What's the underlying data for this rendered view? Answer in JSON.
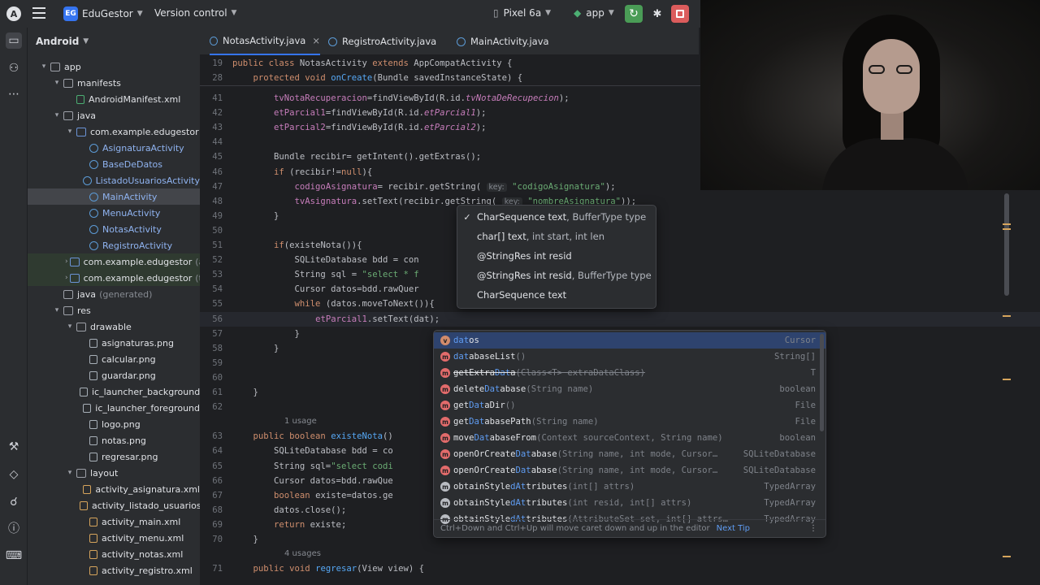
{
  "topbar": {
    "logo_glyph": "A",
    "project_badge": "EG",
    "project_name": "EduGestor",
    "version_control": "Version control",
    "device": "Pixel 6a",
    "run_config": "app"
  },
  "sidebar_title": "Android",
  "tree": [
    {
      "label": "app",
      "indent": 0,
      "arrow": "open",
      "icon": "folder"
    },
    {
      "label": "manifests",
      "indent": 1,
      "arrow": "open",
      "icon": "folder"
    },
    {
      "label": "AndroidManifest.xml",
      "indent": 2,
      "arrow": "none",
      "icon": "mf"
    },
    {
      "label": "java",
      "indent": 1,
      "arrow": "open",
      "icon": "folder"
    },
    {
      "label": "com.example.edugestor",
      "indent": 2,
      "arrow": "open",
      "icon": "folder"
    },
    {
      "label": "AsignaturaActivity",
      "indent": 3,
      "arrow": "none",
      "icon": "class"
    },
    {
      "label": "BaseDeDatos",
      "indent": 3,
      "arrow": "none",
      "icon": "class"
    },
    {
      "label": "ListadoUsuariosActivity",
      "indent": 3,
      "arrow": "none",
      "icon": "class"
    },
    {
      "label": "MainActivity",
      "indent": 3,
      "arrow": "none",
      "icon": "class",
      "selected": true
    },
    {
      "label": "MenuActivity",
      "indent": 3,
      "arrow": "none",
      "icon": "class"
    },
    {
      "label": "NotasActivity",
      "indent": 3,
      "arrow": "none",
      "icon": "class"
    },
    {
      "label": "RegistroActivity",
      "indent": 3,
      "arrow": "none",
      "icon": "class"
    },
    {
      "label": "com.example.edugestor",
      "suffix": "(a",
      "indent": 2,
      "arrow": "closed",
      "icon": "folder",
      "green": true
    },
    {
      "label": "com.example.edugestor",
      "suffix": "(te",
      "indent": 2,
      "arrow": "closed",
      "icon": "folder",
      "green": true
    },
    {
      "label": "java",
      "suffix": "(generated)",
      "indent": 1,
      "arrow": "none",
      "icon": "folder"
    },
    {
      "label": "res",
      "indent": 1,
      "arrow": "open",
      "icon": "folder"
    },
    {
      "label": "drawable",
      "indent": 2,
      "arrow": "open",
      "icon": "folder"
    },
    {
      "label": "asignaturas.png",
      "indent": 3,
      "arrow": "none",
      "icon": "file"
    },
    {
      "label": "calcular.png",
      "indent": 3,
      "arrow": "none",
      "icon": "file"
    },
    {
      "label": "guardar.png",
      "indent": 3,
      "arrow": "none",
      "icon": "file"
    },
    {
      "label": "ic_launcher_background",
      "indent": 3,
      "arrow": "none",
      "icon": "file"
    },
    {
      "label": "ic_launcher_foreground",
      "indent": 3,
      "arrow": "none",
      "icon": "file"
    },
    {
      "label": "logo.png",
      "indent": 3,
      "arrow": "none",
      "icon": "file"
    },
    {
      "label": "notas.png",
      "indent": 3,
      "arrow": "none",
      "icon": "file"
    },
    {
      "label": "regresar.png",
      "indent": 3,
      "arrow": "none",
      "icon": "file"
    },
    {
      "label": "layout",
      "indent": 2,
      "arrow": "open",
      "icon": "folder"
    },
    {
      "label": "activity_asignatura.xml",
      "indent": 3,
      "arrow": "none",
      "icon": "xml"
    },
    {
      "label": "activity_listado_usuarios",
      "indent": 3,
      "arrow": "none",
      "icon": "xml"
    },
    {
      "label": "activity_main.xml",
      "indent": 3,
      "arrow": "none",
      "icon": "xml"
    },
    {
      "label": "activity_menu.xml",
      "indent": 3,
      "arrow": "none",
      "icon": "xml"
    },
    {
      "label": "activity_notas.xml",
      "indent": 3,
      "arrow": "none",
      "icon": "xml"
    },
    {
      "label": "activity_registro.xml",
      "indent": 3,
      "arrow": "none",
      "icon": "xml"
    }
  ],
  "tabs": [
    {
      "label": "NotasActivity.java",
      "active": true,
      "close": "×"
    },
    {
      "label": "RegistroActivity.java",
      "active": false
    },
    {
      "label": "MainActivity.java",
      "active": false
    }
  ],
  "sticky_lines": [
    {
      "num": "19",
      "segments": [
        [
          "kw",
          "public class "
        ],
        [
          "",
          "NotasActivity "
        ],
        [
          "kw",
          "extends "
        ],
        [
          "",
          "AppCompatActivity {"
        ]
      ]
    },
    {
      "num": "28",
      "segments": [
        [
          "kw",
          "    protected void "
        ],
        [
          "fn",
          "onCreate"
        ],
        [
          "",
          "(Bundle savedInstanceState) {"
        ]
      ]
    }
  ],
  "code_lines": [
    {
      "num": "41",
      "segments": [
        [
          "",
          "        "
        ],
        [
          "fld",
          "tvNotaRecuperacion"
        ],
        [
          "",
          "=findViewById(R.id."
        ],
        [
          "itf",
          "tvNotaDeRecupecion"
        ],
        [
          "",
          ");"
        ]
      ]
    },
    {
      "num": "42",
      "segments": [
        [
          "",
          "        "
        ],
        [
          "fld",
          "etParcial1"
        ],
        [
          "",
          "=findViewById(R.id."
        ],
        [
          "itf",
          "etParcial1"
        ],
        [
          "",
          ");"
        ]
      ]
    },
    {
      "num": "43",
      "segments": [
        [
          "",
          "        "
        ],
        [
          "fld",
          "etParcial2"
        ],
        [
          "",
          "=findViewById(R.id."
        ],
        [
          "itf",
          "etParcial2"
        ],
        [
          "",
          ");"
        ]
      ]
    },
    {
      "num": "44",
      "segments": []
    },
    {
      "num": "45",
      "segments": [
        [
          "",
          "        Bundle recibir= getIntent().getExtras();"
        ]
      ]
    },
    {
      "num": "46",
      "segments": [
        [
          "",
          "        "
        ],
        [
          "kw",
          "if "
        ],
        [
          "",
          "(recibir!="
        ],
        [
          "kw",
          "null"
        ],
        [
          "",
          "){"
        ]
      ]
    },
    {
      "num": "47",
      "segments": [
        [
          "",
          "            "
        ],
        [
          "fld",
          "codigoAsignatura"
        ],
        [
          "",
          "= recibir.getString( "
        ],
        [
          "hint",
          "key:"
        ],
        [
          "str",
          " \"codigoAsignatura\""
        ],
        [
          "",
          ");"
        ]
      ]
    },
    {
      "num": "48",
      "segments": [
        [
          "",
          "            "
        ],
        [
          "fld",
          "tvAsignatura"
        ],
        [
          "",
          ".setText(recibir.getString( "
        ],
        [
          "hint",
          "key:"
        ],
        [
          "str",
          " \"nombreAsignatura\""
        ],
        [
          "",
          "));"
        ]
      ]
    },
    {
      "num": "49",
      "segments": [
        [
          "",
          "        }"
        ]
      ]
    },
    {
      "num": "50",
      "segments": []
    },
    {
      "num": "51",
      "segments": [
        [
          "",
          "        "
        ],
        [
          "kw",
          "if"
        ],
        [
          "",
          "(existeNota()){"
        ]
      ]
    },
    {
      "num": "52",
      "segments": [
        [
          "",
          "            SQLiteDatabase bdd = con"
        ]
      ]
    },
    {
      "num": "53",
      "segments": [
        [
          "",
          "            String sql = "
        ],
        [
          "str",
          "\"select * f"
        ]
      ]
    },
    {
      "num": "54",
      "segments": [
        [
          "",
          "            Cursor datos=bdd.rawQuer"
        ],
        [
          "",
          "                                      );"
        ]
      ]
    },
    {
      "num": "55",
      "segments": [
        [
          "",
          "            "
        ],
        [
          "kw",
          "while "
        ],
        [
          "",
          "(datos.moveToNext()){"
        ]
      ]
    },
    {
      "num": "56",
      "segments": [
        [
          "",
          "                "
        ],
        [
          "fld",
          "etParcial1"
        ],
        [
          "",
          ".setText(dat);"
        ]
      ],
      "caret": true
    },
    {
      "num": "57",
      "segments": [
        [
          "",
          "            }"
        ]
      ]
    },
    {
      "num": "58",
      "segments": [
        [
          "",
          "        }"
        ]
      ]
    },
    {
      "num": "59",
      "segments": []
    },
    {
      "num": "60",
      "segments": []
    },
    {
      "num": "61",
      "segments": [
        [
          "",
          "    }"
        ]
      ]
    },
    {
      "num": "62",
      "segments": []
    },
    {
      "num": "",
      "usages": "1 usage"
    },
    {
      "num": "63",
      "segments": [
        [
          "kw",
          "    public boolean "
        ],
        [
          "fn",
          "existeNota"
        ],
        [
          "",
          "()"
        ]
      ]
    },
    {
      "num": "64",
      "segments": [
        [
          "",
          "        SQLiteDatabase bdd = co"
        ]
      ]
    },
    {
      "num": "65",
      "segments": [
        [
          "",
          "        String sql="
        ],
        [
          "str",
          "\"select codi"
        ]
      ]
    },
    {
      "num": "66",
      "segments": [
        [
          "",
          "        Cursor datos=bdd.rawQue"
        ]
      ]
    },
    {
      "num": "67",
      "segments": [
        [
          "kw",
          "        boolean "
        ],
        [
          "",
          "existe=datos.ge"
        ]
      ]
    },
    {
      "num": "68",
      "segments": [
        [
          "",
          "        datos.close();"
        ]
      ]
    },
    {
      "num": "69",
      "segments": [
        [
          "kw",
          "        return "
        ],
        [
          "",
          "existe;"
        ]
      ]
    },
    {
      "num": "70",
      "segments": [
        [
          "",
          "    }"
        ]
      ]
    },
    {
      "num": "",
      "usages": "4 usages"
    },
    {
      "num": "71",
      "segments": [
        [
          "kw",
          "    public void "
        ],
        [
          "fn",
          "regresar"
        ],
        [
          "",
          "(View view) {"
        ]
      ]
    }
  ],
  "param_info": [
    {
      "check": true,
      "bold": "CharSequence text",
      "rest": ", BufferType type"
    },
    {
      "check": false,
      "bold": "char[] text",
      "rest": ", int start, int len"
    },
    {
      "check": false,
      "bold": "@StringRes int resid",
      "rest": ""
    },
    {
      "check": false,
      "bold": "@StringRes int resid",
      "rest": ", BufferType type"
    },
    {
      "check": false,
      "bold": "CharSequence text",
      "rest": ""
    }
  ],
  "completions": [
    {
      "icon": "v",
      "pre": "",
      "match": "dat",
      "post": "os",
      "params": "",
      "type": "Cursor",
      "selected": true
    },
    {
      "icon": "m",
      "pre": "",
      "match": "dat",
      "post": "abaseList",
      "params": "()",
      "type": "String[]"
    },
    {
      "icon": "m",
      "pre": "getExtra",
      "match": "Dat",
      "post": "a",
      "params": "(Class<T> extraDataClass)",
      "type": "T",
      "strike": true
    },
    {
      "icon": "m",
      "pre": "delete",
      "match": "Dat",
      "post": "abase",
      "params": "(String name)",
      "type": "boolean"
    },
    {
      "icon": "m",
      "pre": "get",
      "match": "Dat",
      "post": "aDir",
      "params": "()",
      "type": "File"
    },
    {
      "icon": "m",
      "pre": "get",
      "match": "Dat",
      "post": "abasePath",
      "params": "(String name)",
      "type": "File"
    },
    {
      "icon": "m",
      "pre": "move",
      "match": "Dat",
      "post": "abaseFrom",
      "params": "(Context sourceContext, String name)",
      "type": "boolean"
    },
    {
      "icon": "m",
      "pre": "openOrCreate",
      "match": "Dat",
      "post": "abase",
      "params": "(String name, int mode, Cursor…",
      "type": "SQLiteDatabase"
    },
    {
      "icon": "m",
      "pre": "openOrCreate",
      "match": "Dat",
      "post": "abase",
      "params": "(String name, int mode, Cursor…",
      "type": "SQLiteDatabase"
    },
    {
      "icon": "s",
      "pre": "obtainStyle",
      "match": "dAt",
      "post": "tributes",
      "params": "(int[] attrs)",
      "type": "TypedArray"
    },
    {
      "icon": "s",
      "pre": "obtainStyle",
      "match": "dAt",
      "post": "tributes",
      "params": "(int resid, int[] attrs)",
      "type": "TypedArray"
    },
    {
      "icon": "s",
      "pre": "obtainStyle",
      "match": "dAt",
      "post": "tributes",
      "params": "(AttributeSet set, int[] attrs…",
      "type": "TypedArray"
    }
  ],
  "completion_footer": {
    "hint": "Ctrl+Down and Ctrl+Up will move caret down and up in the editor",
    "link": "Next Tip",
    "more": "⋮"
  },
  "colors": {
    "accent": "#3574f0",
    "run_green": "#4a9c56",
    "stop_red": "#db5c5c",
    "background": "#1e1f22",
    "panel": "#2b2d30"
  }
}
